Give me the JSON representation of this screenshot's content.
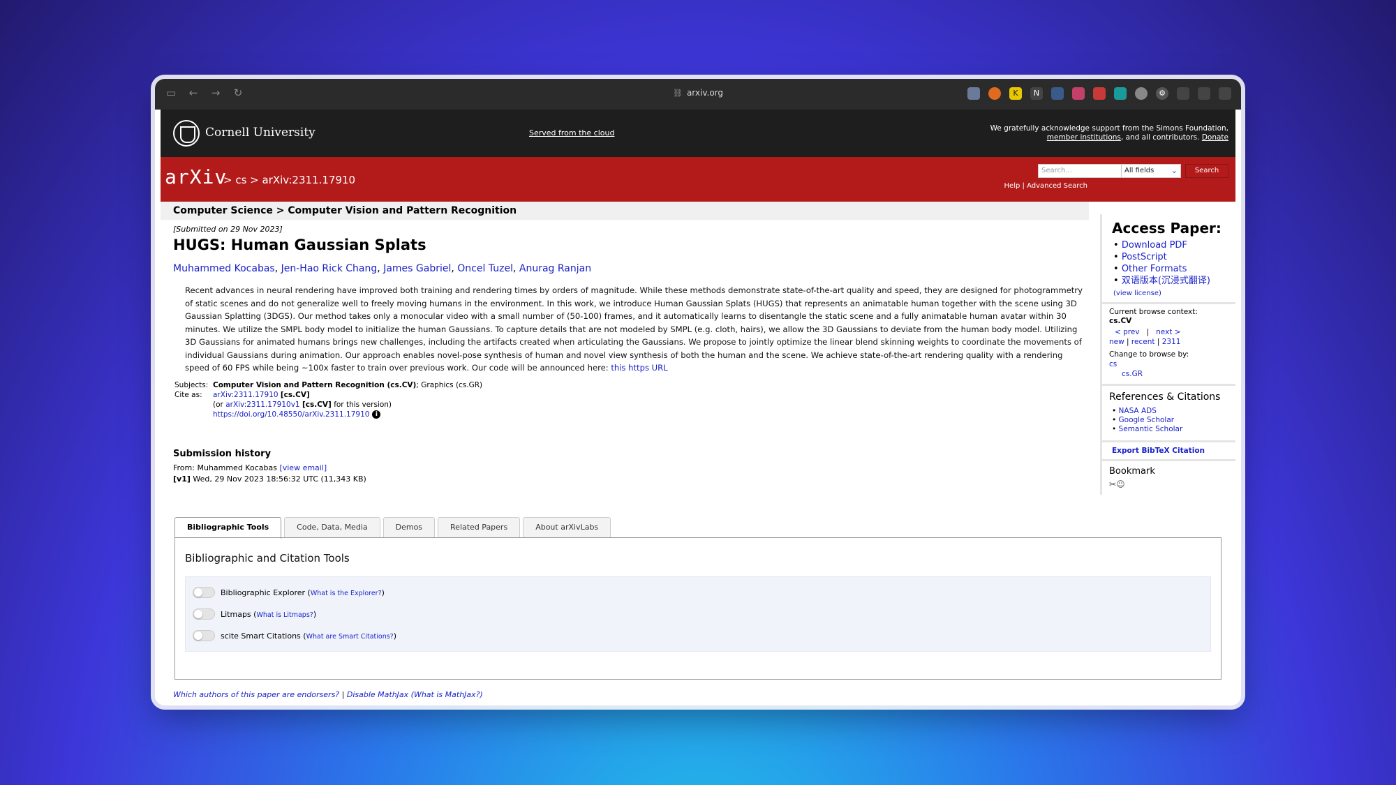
{
  "browser": {
    "url": "arxiv.org"
  },
  "header": {
    "university": "Cornell University",
    "served": "Served from the cloud",
    "ack_line1": "We gratefully acknowledge support from the Simons Foundation,",
    "ack_member": "member institutions",
    "ack_mid": ", and all contributors.",
    "ack_donate": "Donate"
  },
  "arxiv_bar": {
    "logo": "arXiv",
    "breadcrumb": "> cs > arXiv:2311.17910",
    "search_placeholder": "Search...",
    "field_select": "All fields",
    "search_button": "Search",
    "help": "Help",
    "advanced": "Advanced Search"
  },
  "paper": {
    "category": "Computer Science > Computer Vision and Pattern Recognition",
    "submitted": "[Submitted on 29 Nov 2023]",
    "title": "HUGS: Human Gaussian Splats",
    "authors": [
      "Muhammed Kocabas",
      "Jen-Hao Rick Chang",
      "James Gabriel",
      "Oncel Tuzel",
      "Anurag Ranjan"
    ],
    "abstract": "Recent advances in neural rendering have improved both training and rendering times by orders of magnitude. While these methods demonstrate state-of-the-art quality and speed, they are designed for photogrammetry of static scenes and do not generalize well to freely moving humans in the environment. In this work, we introduce Human Gaussian Splats (HUGS) that represents an animatable human together with the scene using 3D Gaussian Splatting (3DGS). Our method takes only a monocular video with a small number of (50-100) frames, and it automatically learns to disentangle the static scene and a fully animatable human avatar within 30 minutes. We utilize the SMPL body model to initialize the human Gaussians. To capture details that are not modeled by SMPL (e.g. cloth, hairs), we allow the 3D Gaussians to deviate from the human body model. Utilizing 3D Gaussians for animated humans brings new challenges, including the artifacts created when articulating the Gaussians. We propose to jointly optimize the linear blend skinning weights to coordinate the movements of individual Gaussians during animation. Our approach enables novel-pose synthesis of human and novel view synthesis of both the human and the scene. We achieve state-of-the-art rendering quality with a rendering speed of 60 FPS while being ~100x faster to train over previous work. Our code will be announced here:",
    "abstract_link": "this https URL",
    "subjects_label": "Subjects:",
    "subjects_primary": "Computer Vision and Pattern Recognition (cs.CV)",
    "subjects_rest": "; Graphics (cs.GR)",
    "cite_label": "Cite as:",
    "cite_id": "arXiv:2311.17910",
    "cite_cat": "[cs.CV]",
    "cite_or": "(or",
    "cite_v1": "arXiv:2311.17910v1",
    "cite_v1_cat": "[cs.CV]",
    "cite_v1_suffix": "for this version)",
    "doi": "https://doi.org/10.48550/arXiv.2311.17910",
    "history_title": "Submission history",
    "history_from": "From: Muhammed Kocabas",
    "history_email": "[view email]",
    "history_v1_tag": "[v1]",
    "history_v1": "Wed, 29 Nov 2023 18:56:32 UTC (11,343 KB)"
  },
  "tabs": [
    "Bibliographic Tools",
    "Code, Data, Media",
    "Demos",
    "Related Papers",
    "About arXivLabs"
  ],
  "tools": {
    "title": "Bibliographic and Citation Tools",
    "items": [
      {
        "label": "Bibliographic Explorer",
        "link": "What is the Explorer?"
      },
      {
        "label": "Litmaps",
        "link": "What is Litmaps?"
      },
      {
        "label": "scite Smart Citations",
        "link": "What are Smart Citations?"
      }
    ]
  },
  "footer": {
    "endorsers": "Which authors of this paper are endorsers?",
    "sep": " | ",
    "mathjax": "Disable MathJax",
    "what_mathjax": "(What is MathJax?)"
  },
  "sidebar": {
    "access_title": "Access Paper:",
    "access_items": [
      "Download PDF",
      "PostScript",
      "Other Formats",
      "双语版本(沉浸式翻译)"
    ],
    "view_license": "(view license)",
    "browse_context_label": "Current browse context:",
    "browse_context": "cs.CV",
    "prev": "< prev",
    "pipe": "|",
    "next": "next >",
    "new": "new",
    "recent": "recent",
    "num": "2311",
    "change_label": "Change to browse by:",
    "browse_cs": "cs",
    "browse_csgr": "cs.GR",
    "refs_title": "References & Citations",
    "refs": [
      "NASA ADS",
      "Google Scholar",
      "Semantic Scholar"
    ],
    "bibtex": "Export BibTeX Citation",
    "bookmark": "Bookmark"
  }
}
